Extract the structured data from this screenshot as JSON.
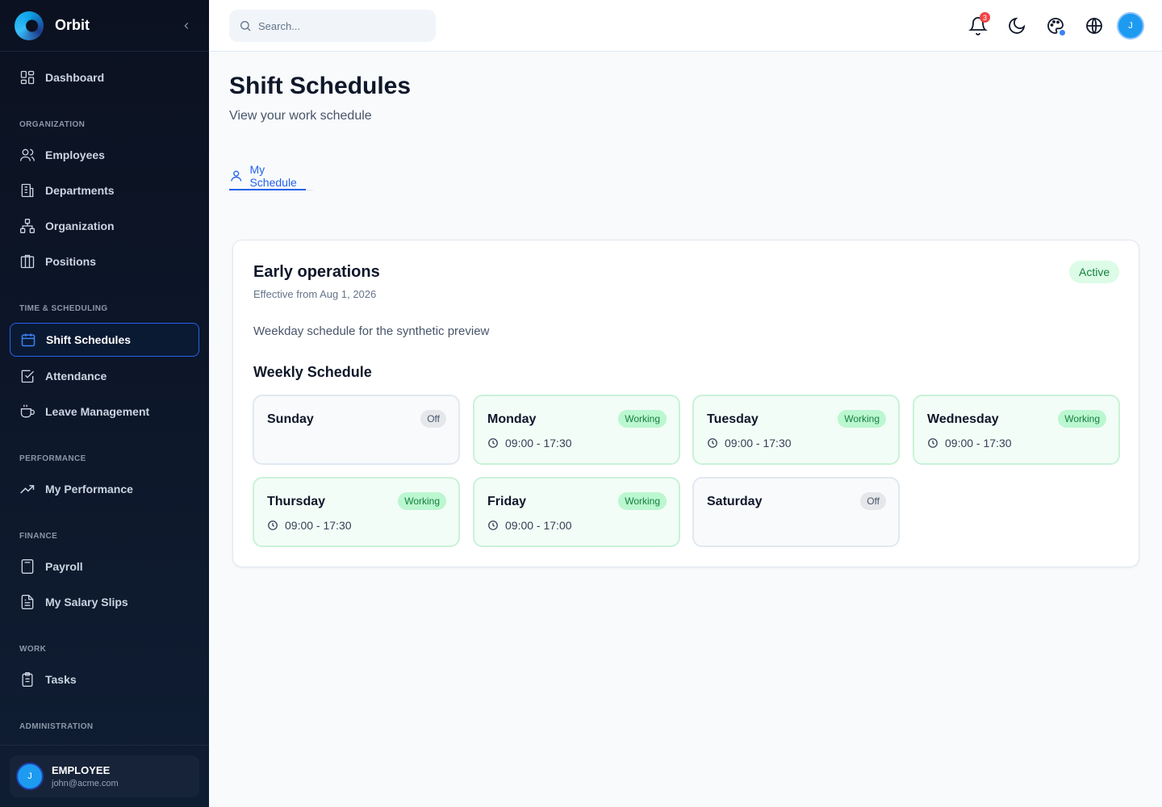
{
  "app": {
    "name": "Orbit"
  },
  "sidebar": {
    "dashboard": "Dashboard",
    "sections": {
      "organization": "ORGANIZATION",
      "time": "TIME & SCHEDULING",
      "performance": "PERFORMANCE",
      "finance": "FINANCE",
      "work": "WORK",
      "admin": "ADMINISTRATION"
    },
    "items": {
      "employees": "Employees",
      "departments": "Departments",
      "organization": "Organization",
      "positions": "Positions",
      "shift_schedules": "Shift Schedules",
      "attendance": "Attendance",
      "leave": "Leave Management",
      "my_performance": "My Performance",
      "payroll": "Payroll",
      "salary_slips": "My Salary Slips",
      "tasks": "Tasks"
    },
    "user": {
      "initial": "J",
      "role": "EMPLOYEE",
      "email": "john@acme.com"
    }
  },
  "header": {
    "search_placeholder": "Search...",
    "notification_count": "3",
    "avatar_initial": "J"
  },
  "page": {
    "title": "Shift Schedules",
    "subtitle": "View your work schedule",
    "tab": "My Schedule"
  },
  "schedule": {
    "name": "Early operations",
    "effective": "Effective from Aug 1, 2026",
    "status": "Active",
    "description": "Weekday schedule for the synthetic preview",
    "weekly_title": "Weekly Schedule",
    "days": [
      {
        "name": "Sunday",
        "status": "Off",
        "time": ""
      },
      {
        "name": "Monday",
        "status": "Working",
        "time": "09:00 - 17:30"
      },
      {
        "name": "Tuesday",
        "status": "Working",
        "time": "09:00 - 17:30"
      },
      {
        "name": "Wednesday",
        "status": "Working",
        "time": "09:00 - 17:30"
      },
      {
        "name": "Thursday",
        "status": "Working",
        "time": "09:00 - 17:30"
      },
      {
        "name": "Friday",
        "status": "Working",
        "time": "09:00 - 17:00"
      },
      {
        "name": "Saturday",
        "status": "Off",
        "time": ""
      }
    ]
  },
  "colors": {
    "accent": "#2563eb",
    "sidebar_bg": "#0b1120",
    "working": "#15803d",
    "working_bg": "#dcfce7"
  }
}
